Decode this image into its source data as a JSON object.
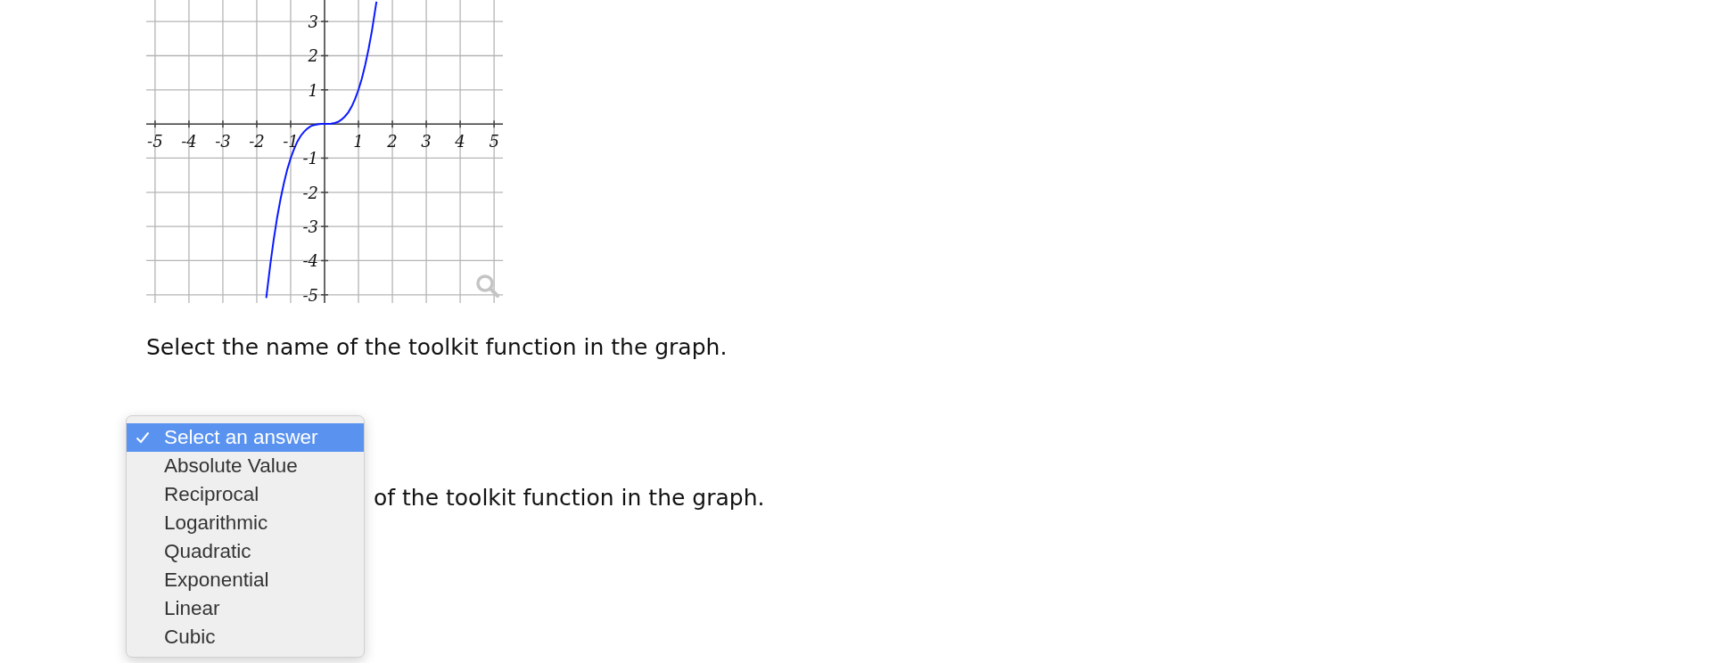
{
  "graph": {
    "chart_data": {
      "type": "line",
      "grid": true,
      "xlim": [
        -5.26,
        5.26
      ],
      "ylim": [
        -5.24,
        3.63
      ],
      "xticks": [
        {
          "value": -5,
          "label": "-5"
        },
        {
          "value": -4,
          "label": "-4"
        },
        {
          "value": -3,
          "label": "-3"
        },
        {
          "value": -2,
          "label": "-2"
        },
        {
          "value": -1,
          "label": "-1"
        },
        {
          "value": 1,
          "label": "1"
        },
        {
          "value": 2,
          "label": "2"
        },
        {
          "value": 3,
          "label": "3"
        },
        {
          "value": 4,
          "label": "4"
        },
        {
          "value": 5,
          "label": "5"
        }
      ],
      "yticks": [
        {
          "value": 3,
          "label": "3"
        },
        {
          "value": 2,
          "label": "2"
        },
        {
          "value": 1,
          "label": "1"
        },
        {
          "value": -1,
          "label": "-1"
        },
        {
          "value": -2,
          "label": "-2"
        },
        {
          "value": -3,
          "label": "-3"
        },
        {
          "value": -4,
          "label": "-4"
        },
        {
          "value": -5,
          "label": "-5"
        }
      ],
      "x": [
        -1.72,
        -1.6,
        -1.5,
        -1.4,
        -1.3,
        -1.2,
        -1.1,
        -1.0,
        -0.9,
        -0.8,
        -0.7,
        -0.6,
        -0.5,
        -0.4,
        -0.3,
        -0.2,
        -0.1,
        0,
        0.1,
        0.2,
        0.3,
        0.4,
        0.5,
        0.6,
        0.7,
        0.8,
        0.9,
        1.0,
        1.1,
        1.2,
        1.3,
        1.4,
        1.5,
        1.53
      ],
      "series": [
        {
          "color": "#0a1aff",
          "values": [
            -5.09,
            -4.1,
            -3.38,
            -2.74,
            -2.2,
            -1.73,
            -1.33,
            -1.0,
            -0.73,
            -0.51,
            -0.34,
            -0.22,
            -0.13,
            -0.06,
            -0.03,
            -0.01,
            0,
            0,
            0,
            0.01,
            0.03,
            0.06,
            0.13,
            0.22,
            0.34,
            0.51,
            0.73,
            1.0,
            1.33,
            1.73,
            2.2,
            2.74,
            3.38,
            3.58
          ]
        }
      ]
    }
  },
  "question": "Select the name of the toolkit function in the graph.",
  "question_repeat": "of the toolkit function in the graph.",
  "dropdown": {
    "options": [
      {
        "label": "Select an answer",
        "selected": true
      },
      {
        "label": "Absolute Value",
        "selected": false
      },
      {
        "label": "Reciprocal",
        "selected": false
      },
      {
        "label": "Logarithmic",
        "selected": false
      },
      {
        "label": "Quadratic",
        "selected": false
      },
      {
        "label": "Exponential",
        "selected": false
      },
      {
        "label": "Linear",
        "selected": false
      },
      {
        "label": "Cubic",
        "selected": false
      }
    ]
  }
}
